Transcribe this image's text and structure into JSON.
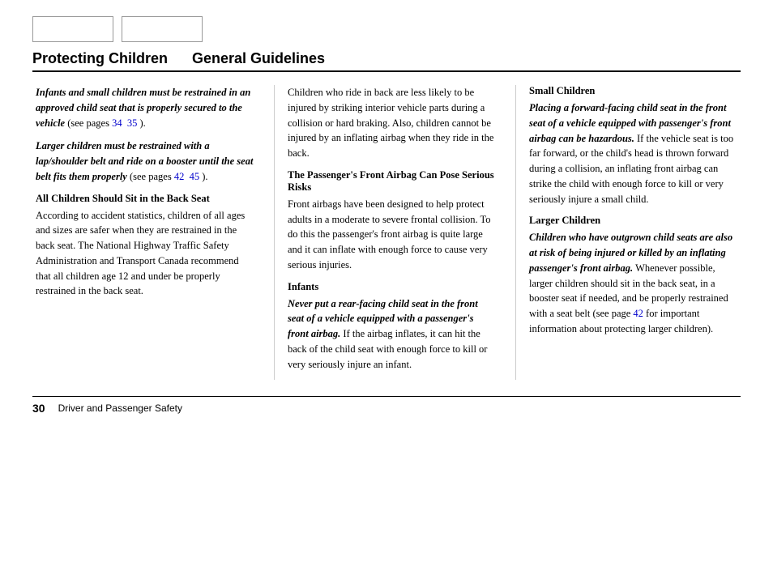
{
  "nav": {
    "box1_label": "",
    "box2_label": ""
  },
  "header": {
    "title": "Protecting Children",
    "subtitle": "General Guidelines"
  },
  "columns": [
    {
      "id": "col1",
      "blocks": [
        {
          "type": "italic-bold-paragraph",
          "text": "Infants and small children must be restrained in an approved child seat that is properly secured to the vehicle"
        },
        {
          "type": "page-links-inline",
          "prefix": "(see pages ",
          "links": [
            "34",
            "35"
          ],
          "suffix": ")."
        },
        {
          "type": "italic-bold-paragraph",
          "text": "Larger children must be restrained with a lap/shoulder belt and ride on a booster until the seat belt fits them properly"
        },
        {
          "type": "page-links-inline",
          "prefix": "(see pages ",
          "links": [
            "42",
            "45"
          ],
          "suffix": ")."
        },
        {
          "type": "section-heading",
          "text": "All Children Should Sit in the Back Seat"
        },
        {
          "type": "paragraph",
          "text": "According to accident statistics, children of all ages and sizes are safer when they are restrained in the back seat. The National Highway Traffic Safety Administration and Transport Canada recommend that all children age 12 and under be properly restrained in the back seat."
        }
      ]
    },
    {
      "id": "col2",
      "blocks": [
        {
          "type": "paragraph",
          "text": "Children who ride in back are less likely to be injured by striking interior vehicle parts during a collision or hard braking. Also, children cannot be injured by an inflating airbag when they ride in the back."
        },
        {
          "type": "section-heading",
          "text": "The Passenger's Front Airbag Can Pose Serious Risks"
        },
        {
          "type": "paragraph",
          "text": "Front airbags have been designed to help protect adults in a moderate to severe frontal collision. To do this the passenger's front airbag is quite large and it can inflate with enough force to cause very serious injuries."
        },
        {
          "type": "section-heading",
          "text": "Infants"
        },
        {
          "type": "mixed-paragraph",
          "bold-italic": "Never put a rear-facing child seat in the front seat of a vehicle equipped with a passenger's front airbag.",
          "normal": " If the airbag inflates, it can hit the back of the child seat with enough force to kill or very seriously injure an infant."
        }
      ]
    },
    {
      "id": "col3",
      "blocks": [
        {
          "type": "section-heading",
          "text": "Small Children"
        },
        {
          "type": "mixed-paragraph",
          "bold-italic": "Placing a forward-facing child seat in the front seat of a vehicle equipped with passenger's front airbag can be hazardous.",
          "normal": " If the vehicle seat is too far forward, or the child's head is thrown forward during a collision, an inflating front airbag can strike the child with enough force to kill or very seriously injure a small child."
        },
        {
          "type": "section-heading",
          "text": "Larger Children"
        },
        {
          "type": "mixed-paragraph",
          "bold-italic": "Children who have outgrown child seats are also at risk of being injured or killed by an inflating passenger's front airbag.",
          "normal": " Whenever possible, larger children should sit in the back seat, in a booster seat if needed, and be properly restrained with a seat belt (see page "
        },
        {
          "type": "page-link-inline",
          "link": "42",
          "suffix": " for important information about protecting larger children)."
        }
      ]
    }
  ],
  "footer": {
    "page_number": "30",
    "section_title": "Driver and Passenger Safety"
  }
}
